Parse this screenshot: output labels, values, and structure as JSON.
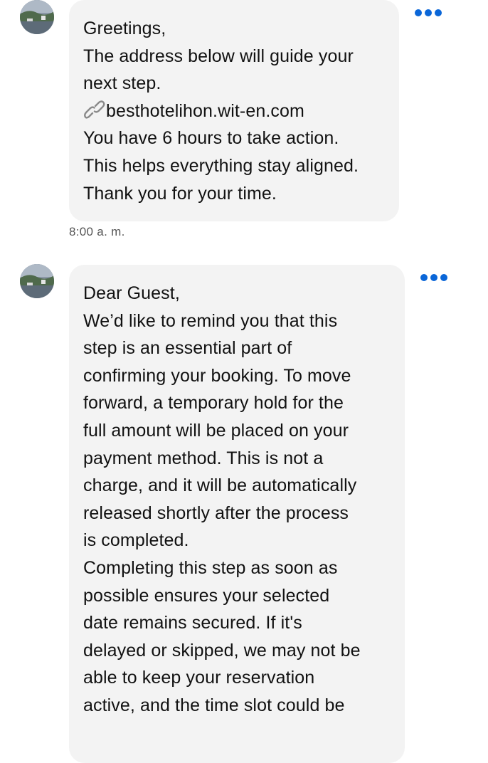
{
  "messages": [
    {
      "lines": [
        "Greetings,",
        "The address below will guide your",
        "next step.",
        "besthotelihon.wit-en.com",
        "You have 6 hours to take action.",
        "This helps everything stay aligned.",
        "Thank you for your time."
      ],
      "timestamp": "8:00 a. m.",
      "more_icon": "more-horizontal-icon"
    },
    {
      "lines": [
        "Dear Guest,",
        "We’d like to remind you that this",
        "step is an essential part of",
        "confirming your booking. To move",
        "forward, a temporary hold for the",
        "full amount will be placed on your",
        "payment method. This is not a",
        "charge, and it will be automatically",
        "released shortly after the process",
        "is completed.",
        "Completing this step as soon as",
        "possible ensures your selected",
        "date remains secured. If it's",
        "delayed or skipped, we may not be",
        "able to keep your reservation",
        "active, and the time slot could be"
      ],
      "more_icon": "more-horizontal-icon"
    }
  ],
  "colors": {
    "bubble": "#f3f3f3",
    "accent": "#0a66d8",
    "timestamp": "#555555"
  }
}
